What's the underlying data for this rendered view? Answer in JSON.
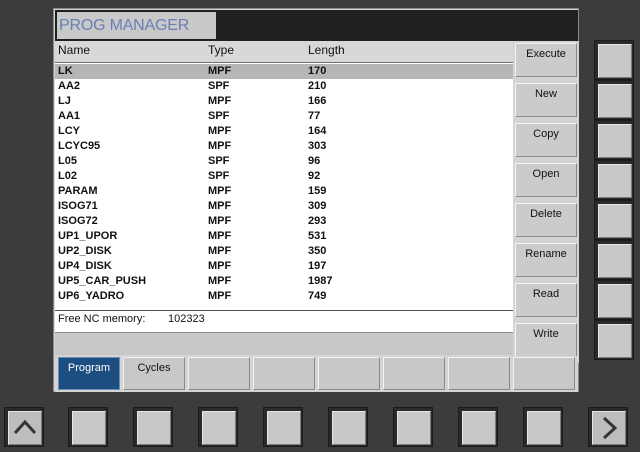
{
  "window": {
    "title": "PROG MANAGER"
  },
  "table": {
    "columns": [
      "Name",
      "Type",
      "Length"
    ],
    "rows": [
      {
        "name": "LK",
        "type": "MPF",
        "length": "170",
        "selected": true
      },
      {
        "name": "AA2",
        "type": "SPF",
        "length": "210"
      },
      {
        "name": "LJ",
        "type": "MPF",
        "length": "166"
      },
      {
        "name": "AA1",
        "type": "SPF",
        "length": "77"
      },
      {
        "name": "LCY",
        "type": "MPF",
        "length": "164"
      },
      {
        "name": "LCYC95",
        "type": "MPF",
        "length": "303"
      },
      {
        "name": "L05",
        "type": "SPF",
        "length": "96"
      },
      {
        "name": "L02",
        "type": "SPF",
        "length": "92"
      },
      {
        "name": "PARAM",
        "type": "MPF",
        "length": "159"
      },
      {
        "name": "ISOG71",
        "type": "MPF",
        "length": "309"
      },
      {
        "name": "ISOG72",
        "type": "MPF",
        "length": "293"
      },
      {
        "name": "UP1_UPOR",
        "type": "MPF",
        "length": "531"
      },
      {
        "name": "UP2_DISK",
        "type": "MPF",
        "length": "350"
      },
      {
        "name": "UP4_DISK",
        "type": "MPF",
        "length": "197"
      },
      {
        "name": "UP5_CAR_PUSH",
        "type": "MPF",
        "length": "1987"
      },
      {
        "name": "UP6_YADRO",
        "type": "MPF",
        "length": "749"
      }
    ]
  },
  "memory": {
    "label": "Free NC memory:",
    "value": "102323"
  },
  "vertical_softkeys": [
    "Execute",
    "New",
    "Copy",
    "Open",
    "Delete",
    "Rename",
    "Read",
    "Write"
  ],
  "horizontal_softkeys": [
    {
      "label": "Program",
      "active": true
    },
    {
      "label": "Cycles"
    },
    {
      "label": ""
    },
    {
      "label": ""
    },
    {
      "label": ""
    },
    {
      "label": ""
    },
    {
      "label": ""
    },
    {
      "label": ""
    }
  ],
  "panel": {
    "bottom_buttons": [
      "recall-arrow-icon",
      "blank",
      "blank",
      "blank",
      "blank",
      "blank",
      "blank",
      "blank",
      "blank",
      "etc-arrow-icon"
    ],
    "side_buttons": 8
  },
  "colors": {
    "accent": "#1d4e82",
    "title_text": "#6a7fb4",
    "bezel": "#3c3c3c"
  }
}
